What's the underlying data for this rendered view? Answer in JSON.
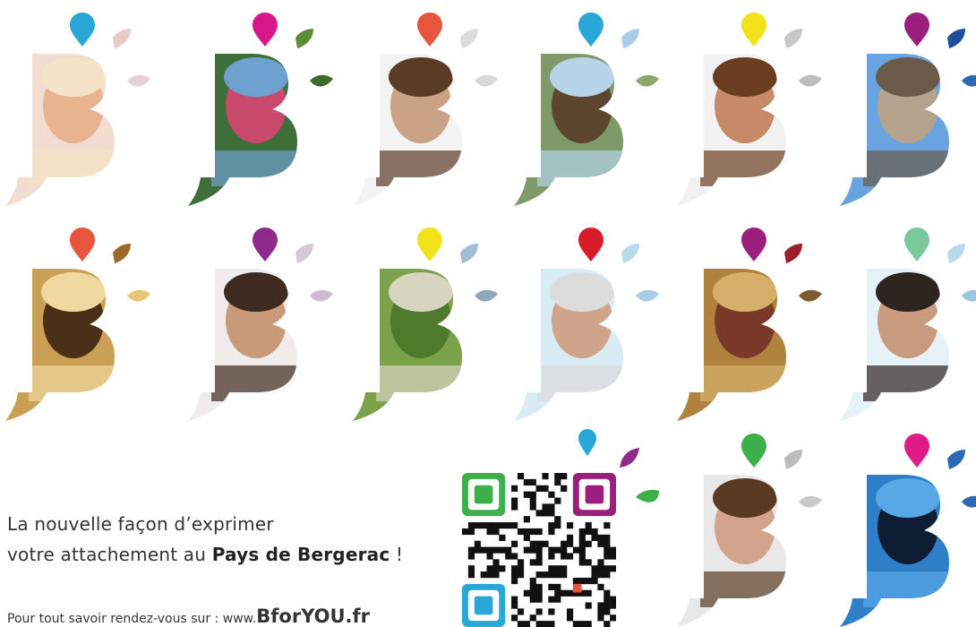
{
  "tagline": {
    "line1": "La nouvelle façon d’exprimer",
    "line2_prefix": "votre attachement au",
    "line2_strong": "Pays de Bergerac",
    "line2_suffix": "!"
  },
  "info": {
    "prefix": "Pour tout savoir rendez-vous sur : www.",
    "site": "BforYOU.fr"
  },
  "tiles": [
    {
      "name": "girl-portrait",
      "pin": "#29a8d8",
      "d1": "#e8c9c9",
      "d2": "#e6d0d8",
      "bg": "#f2ddd0",
      "fg": "#e7b48f",
      "accent": "#f5e3c7"
    },
    {
      "name": "canoe-river",
      "pin": "#d6198a",
      "d1": "#5e8a3a",
      "d2": "#3d6b2e",
      "bg": "#3e6e3a",
      "fg": "#c94a6c",
      "accent": "#6ea0d0"
    },
    {
      "name": "teen-boy-portrait",
      "pin": "#e8553e",
      "d1": "#dcdcdc",
      "d2": "#d8d8d8",
      "bg": "#f3f3f3",
      "fg": "#caa286",
      "accent": "#5b3a26"
    },
    {
      "name": "gabarre-boat",
      "pin": "#29a8d8",
      "d1": "#a9cde8",
      "d2": "#8da86a",
      "bg": "#7d9a68",
      "fg": "#5c4630",
      "accent": "#b7d3e8"
    },
    {
      "name": "woman-portrait",
      "pin": "#f2e21a",
      "d1": "#c8c8c8",
      "d2": "#bdbdbd",
      "bg": "#f2f2f2",
      "fg": "#c68a68",
      "accent": "#6b3e22"
    },
    {
      "name": "chateau",
      "pin": "#9b1f7d",
      "d1": "#1d4f9c",
      "d2": "#2c6ab3",
      "bg": "#6aa4e0",
      "fg": "#b3a28c",
      "accent": "#6b5a4a"
    },
    {
      "name": "bronze-bust",
      "pin": "#e8553e",
      "d1": "#9b6a2a",
      "d2": "#e8c678",
      "bg": "#caa055",
      "fg": "#4a3016",
      "accent": "#f0d9a0"
    },
    {
      "name": "smiling-man-portrait",
      "pin": "#8e2a8a",
      "d1": "#d8c8d8",
      "d2": "#cdbccd",
      "bg": "#f0ecec",
      "fg": "#c89a7a",
      "accent": "#3e2a1e"
    },
    {
      "name": "vineyard-village",
      "pin": "#f2e21a",
      "d1": "#a3bdd4",
      "d2": "#8fa6bf",
      "bg": "#7ba24a",
      "fg": "#4f7a2c",
      "accent": "#d7d4c0"
    },
    {
      "name": "senior-man-portrait",
      "pin": "#d81c2a",
      "d1": "#b8d8ec",
      "d2": "#a9cde6",
      "bg": "#d8ecf6",
      "fg": "#cfa48a",
      "accent": "#dcdcdc"
    },
    {
      "name": "cyrano-statue",
      "pin": "#9b1f7d",
      "d1": "#9b1f2a",
      "d2": "#7e5a30",
      "bg": "#b0823e",
      "fg": "#7a3a2a",
      "accent": "#d6b06a"
    },
    {
      "name": "young-man-portrait",
      "pin": "#7bc89a",
      "d1": "#b8d8ec",
      "d2": "#9ac6e4",
      "bg": "#e6f2f8",
      "fg": "#c89a7e",
      "accent": "#2e2420"
    },
    {
      "name": "young-woman-portrait",
      "pin": "#3db04a",
      "d1": "#bcbcbc",
      "d2": "#c9c9c9",
      "bg": "#e8e8e8",
      "fg": "#d2a48c",
      "accent": "#5a3a22"
    },
    {
      "name": "aquarium",
      "pin": "#e01a86",
      "d1": "#2c6ab3",
      "d2": "#2c6ab3",
      "bg": "#2f7fc8",
      "fg": "#0d1d33",
      "accent": "#58a8e8"
    }
  ],
  "qr": {
    "frame_colors": [
      "#3db04a",
      "#9b1f7d",
      "#29a8d8"
    ],
    "center_dot": "#e8553e",
    "ink": "#111111"
  },
  "extra_drops": {
    "purple": "#8e2a8a",
    "green": "#3db04a"
  }
}
